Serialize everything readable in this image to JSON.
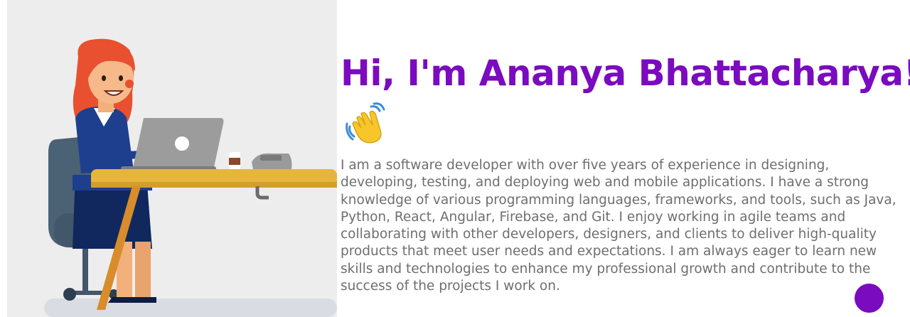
{
  "hero": {
    "title": "Hi, I'm Ananya Bhattacharya!",
    "wave_icon": "waving-hand-emoji",
    "bio": "I am a software developer with over five years of experience in designing, developing, testing, and deploying web and mobile applications. I have a strong knowledge of various programming languages, frameworks, and tools, such as Java, Python, React, Angular, Firebase, and Git. I enjoy working in agile teams and collaborating with other developers, designers, and clients to deliver high-quality products that meet user needs and expectations. I am always eager to learn new skills and technologies to enhance my professional growth and contribute to the success of the projects I work on."
  },
  "colors": {
    "accent": "#7a0bbf",
    "body_text": "#6e6e6e",
    "illustration_bg": "#ededed"
  }
}
